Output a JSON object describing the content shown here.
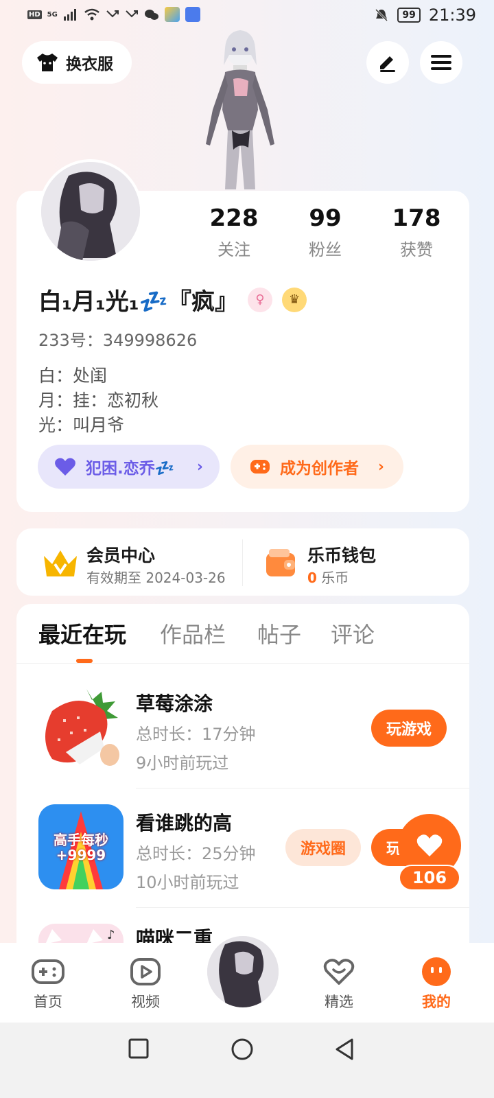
{
  "status_bar": {
    "left_badge": "HD",
    "network": "5G",
    "battery": "99",
    "time": "21:39"
  },
  "header": {
    "outfit_button": "换衣服"
  },
  "profile": {
    "stats": [
      {
        "value": "228",
        "label": "关注"
      },
      {
        "value": "99",
        "label": "粉丝"
      },
      {
        "value": "178",
        "label": "获赞"
      }
    ],
    "nickname": "白₁月₁光₁💤『疯』",
    "id_line": "233号：349998626",
    "bio": [
      "白：处闺",
      "月：挂：恋初秋",
      "光：叫月爷"
    ],
    "relation_pill": "犯困.恋乔💤",
    "creator_pill": "成为创作者"
  },
  "vip": {
    "title": "会员中心",
    "expiry": "有效期至 2024-03-26",
    "wallet_title": "乐币钱包",
    "wallet_amount": "0",
    "wallet_unit": "乐币"
  },
  "tabs": [
    "最近在玩",
    "作品栏",
    "帖子",
    "评论"
  ],
  "games": [
    {
      "title": "草莓涂涂",
      "duration": "总时长：17分钟",
      "last_played": "9小时前玩过",
      "play": "玩游戏"
    },
    {
      "title": "看谁跳的高",
      "duration": "总时长：25分钟",
      "last_played": "10小时前玩过",
      "circle": "游戏圈",
      "play": "玩",
      "icon_text": "高手每秒",
      "icon_text2": "+9999"
    },
    {
      "title": "喵咪二重"
    }
  ],
  "like": {
    "count": "106"
  },
  "nav": [
    "首页",
    "视频",
    "精选",
    "我的"
  ],
  "colors": {
    "accent": "#ff6a1a",
    "purple": "#6b5ce7",
    "vip_gold": "#f7b500"
  }
}
